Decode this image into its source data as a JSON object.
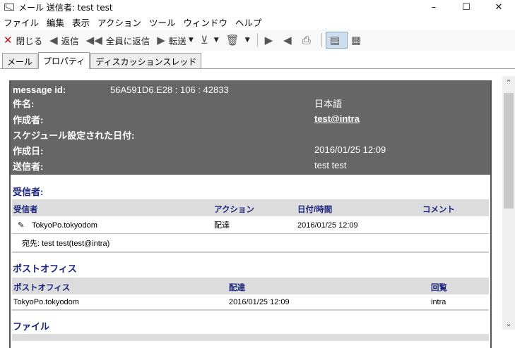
{
  "window": {
    "title": "メール 送信者: test test",
    "minimize": "–",
    "maximize": "☐",
    "close": "✕"
  },
  "menu": [
    "ファイル",
    "編集",
    "表示",
    "アクション",
    "ツール",
    "ウィンドウ",
    "ヘルプ"
  ],
  "toolbar": {
    "close_label": "閉じる",
    "reply_label": "返信",
    "reply_all_label": "全員に返信",
    "forward_label": "転送"
  },
  "tabs": [
    "メール",
    "プロパティ",
    "ディスカッションスレッド"
  ],
  "header": {
    "message_id_label": "message id:",
    "message_id_value": "56A591D6.E28 : 106 : 42833",
    "subject_label": "件名:",
    "subject_value": "日本語",
    "author_label": "作成者:",
    "author_value": "test@intra",
    "scheduled_label": "スケジュール設定された日付:",
    "created_label": "作成日:",
    "created_value": "2016/01/25 12:09",
    "sender_label": "送信者:",
    "sender_value": "test test"
  },
  "recipients": {
    "section_title": "受信者:",
    "columns": [
      "受信者",
      "アクション",
      "日付/時間",
      "コメント"
    ],
    "row": {
      "name": "TokyoPo.tokyodom",
      "action": "配達",
      "datetime": "2016/01/25 12:09",
      "comment": ""
    },
    "to_line": "宛先: test test(test@intra)"
  },
  "post_office": {
    "section_title": "ポストオフィス",
    "columns": [
      "ポストオフィス",
      "配達",
      "回覧"
    ],
    "row": {
      "name": "TokyoPo.tokyodom",
      "delivered": "2016/01/25 12:09",
      "route": "intra"
    }
  },
  "files": {
    "section_title": "ファイル"
  }
}
